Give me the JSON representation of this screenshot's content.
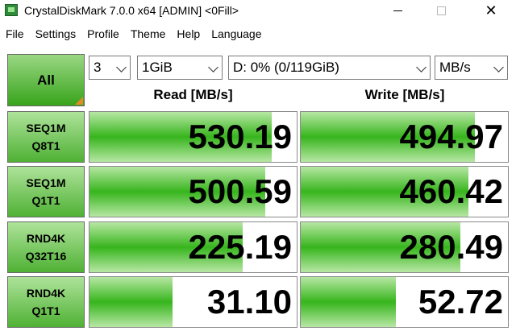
{
  "window": {
    "title": "CrystalDiskMark 7.0.0 x64 [ADMIN] <0Fill>",
    "icon": "crystaldiskmark-app-icon",
    "close_glyph": "✕"
  },
  "menu": [
    "File",
    "Settings",
    "Profile",
    "Theme",
    "Help",
    "Language"
  ],
  "controls": {
    "all_label": "All",
    "count": "3",
    "size": "1GiB",
    "drive": "D: 0% (0/119GiB)",
    "unit": "MB/s"
  },
  "headers": {
    "read": "Read [MB/s]",
    "write": "Write [MB/s]"
  },
  "colors": {
    "button_green": "#38a41c",
    "bar_green": "#37b51d",
    "corner_orange": "#e58a25"
  },
  "tests": [
    {
      "line1": "SEQ1M",
      "line2": "Q8T1",
      "read": "530.19",
      "write": "494.97",
      "read_fill": 0.88,
      "write_fill": 0.84
    },
    {
      "line1": "SEQ1M",
      "line2": "Q1T1",
      "read": "500.59",
      "write": "460.42",
      "read_fill": 0.85,
      "write_fill": 0.81
    },
    {
      "line1": "RND4K",
      "line2": "Q32T16",
      "read": "225.19",
      "write": "280.49",
      "read_fill": 0.74,
      "write_fill": 0.77
    },
    {
      "line1": "RND4K",
      "line2": "Q1T1",
      "read": "31.10",
      "write": "52.72",
      "read_fill": 0.4,
      "write_fill": 0.46
    }
  ]
}
